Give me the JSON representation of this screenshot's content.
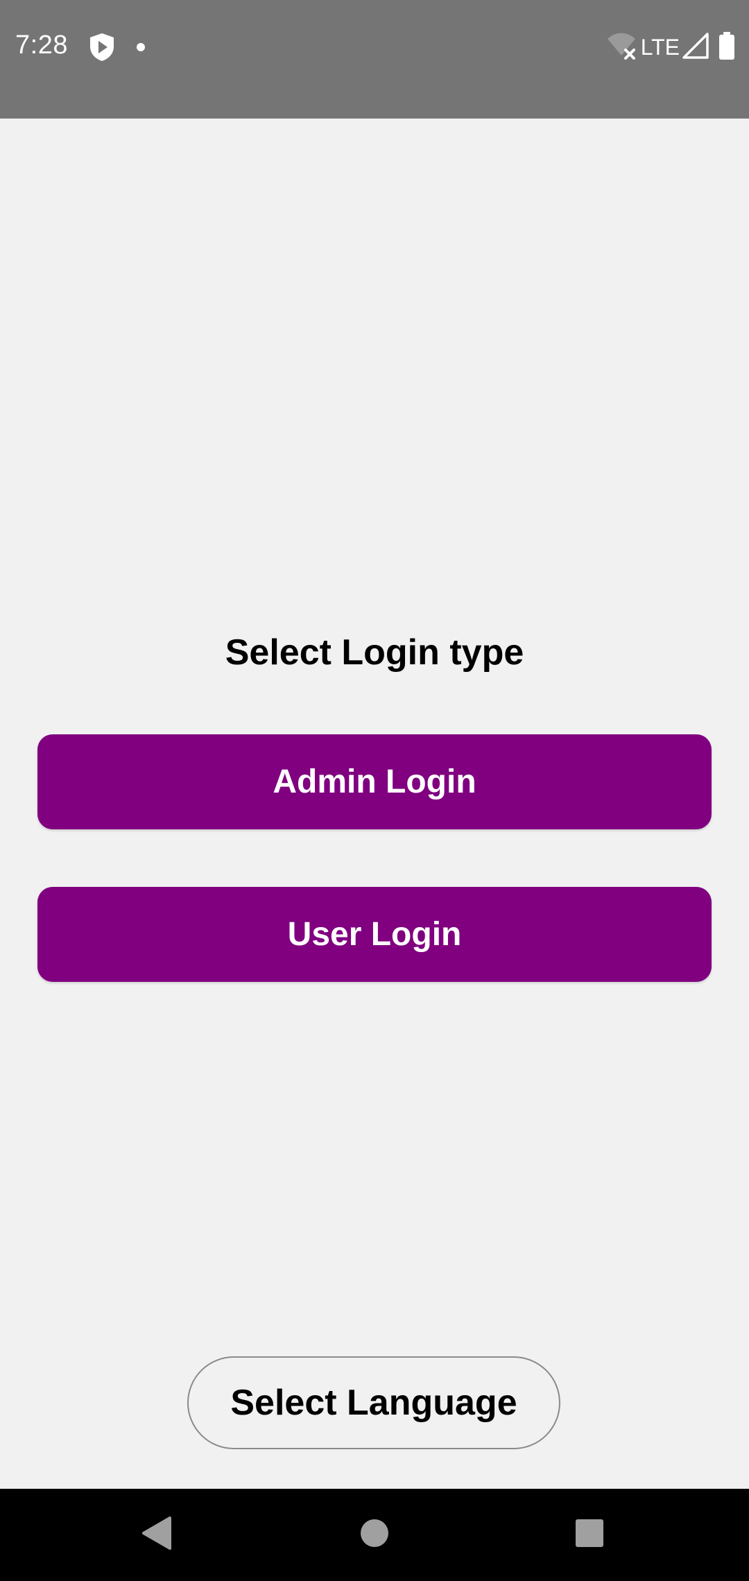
{
  "status_bar": {
    "time": "7:28",
    "left_icons": [
      "shield-play-icon",
      "dot-icon"
    ],
    "network_label": "LTE",
    "right_icons": [
      "wifi-off-icon",
      "signal-icon",
      "battery-icon"
    ]
  },
  "main": {
    "title": "Select Login type",
    "admin_login_label": "Admin Login",
    "user_login_label": "User Login",
    "select_language_label": "Select Language"
  },
  "nav_bar": {
    "icons": [
      "back-icon",
      "home-icon",
      "recents-icon"
    ]
  },
  "colors": {
    "status_bar": "#757575",
    "background": "#f1f1f1",
    "accent": "#800080",
    "nav_bar": "#000000"
  }
}
